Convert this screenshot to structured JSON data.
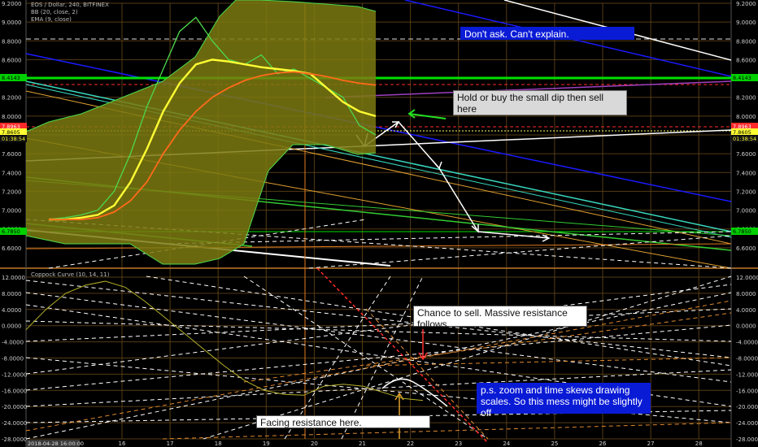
{
  "header": {
    "symbol_line": "EOS / Dollar, 240, BITFINEX",
    "bb_line": "BB (20, close, 2)",
    "ema_line": "EMA (9, close)",
    "lower_indicator": "Coppock Curve (10, 14, 11)"
  },
  "chart_data": [
    {
      "type": "line",
      "pane": "price",
      "ylim": [
        6.4,
        9.2
      ],
      "y_ticks": [
        "9.2000",
        "9.0000",
        "8.8000",
        "8.6000",
        "8.4000",
        "8.2000",
        "8.0000",
        "7.8000",
        "7.6000",
        "7.4000",
        "7.2000",
        "7.0000",
        "6.8000",
        "6.6000"
      ],
      "x_ticks": [
        "16",
        "17",
        "18",
        "19",
        "20",
        "21",
        "22",
        "23",
        "24",
        "25",
        "26",
        "27",
        "28"
      ],
      "date_label": "2018-04-28 16:00:00",
      "price_tags": {
        "left": [
          "8.4143",
          "7.8963",
          "7.8605",
          "01:38:54",
          "6.7850"
        ],
        "right": [
          "8.4143",
          "7.8963",
          "7.8605",
          "01:38:54",
          "6.7850"
        ]
      },
      "series": [
        {
          "values": [
            6.9,
            6.92,
            6.95,
            7.0,
            7.2,
            7.6,
            8.1,
            8.5,
            8.9,
            9.05,
            8.8,
            8.6,
            8.55,
            8.65,
            8.45,
            8.5,
            8.4,
            8.3,
            8.2,
            7.9,
            7.8
          ]
        },
        {
          "values": [
            6.9,
            6.9,
            6.92,
            6.95,
            7.05,
            7.3,
            7.65,
            8.05,
            8.35,
            8.55,
            8.6,
            8.58,
            8.55,
            8.52,
            8.5,
            8.48,
            8.45,
            8.3,
            8.15,
            8.05,
            8.0
          ]
        },
        {
          "values": [
            6.9,
            6.9,
            6.9,
            6.92,
            6.98,
            7.1,
            7.3,
            7.6,
            7.85,
            8.05,
            8.2,
            8.3,
            8.38,
            8.43,
            8.46,
            8.47,
            8.45,
            8.42,
            8.38,
            8.35,
            8.33
          ]
        }
      ],
      "colors": {
        "price": "#4cd94c",
        "ema": "#ffff33",
        "ma": "#ff6a1a",
        "bb_fill": "#7d7a10",
        "bb_edge": "#4cd94c",
        "hline_green": "#00e000",
        "hline_red": "#ff2a2a",
        "blue_trend": "#1a1aff"
      }
    },
    {
      "type": "line",
      "pane": "oscillator",
      "ylim": [
        -28,
        12
      ],
      "y_ticks": [
        "12.0000",
        "8.0000",
        "4.0000",
        "0.0000",
        "-4.0000",
        "-8.0000",
        "-12.0000",
        "-16.0000",
        "-20.0000",
        "-24.0000",
        "-28.0000"
      ],
      "series": [
        {
          "values": [
            -1,
            4,
            8,
            10,
            11,
            9.5,
            6,
            2,
            -2,
            -6,
            -10,
            -13.5,
            -16,
            -17,
            -17.2,
            -15,
            -14.5,
            -15,
            -16.5,
            -18,
            -18.5
          ]
        }
      ],
      "colors": {
        "coppock": "#b5b02a",
        "proj": "#ffffff"
      }
    }
  ],
  "annotations": {
    "dont_ask": "Don't ask. Can't explain.",
    "hold": "Hold or buy the small dip then sell here",
    "chance": "Chance to sell. Massive resistance follows.",
    "ps": "p.s. zoom and time skews drawing scales. So this mess might be slightly off",
    "facing": "Facing resistance here."
  }
}
